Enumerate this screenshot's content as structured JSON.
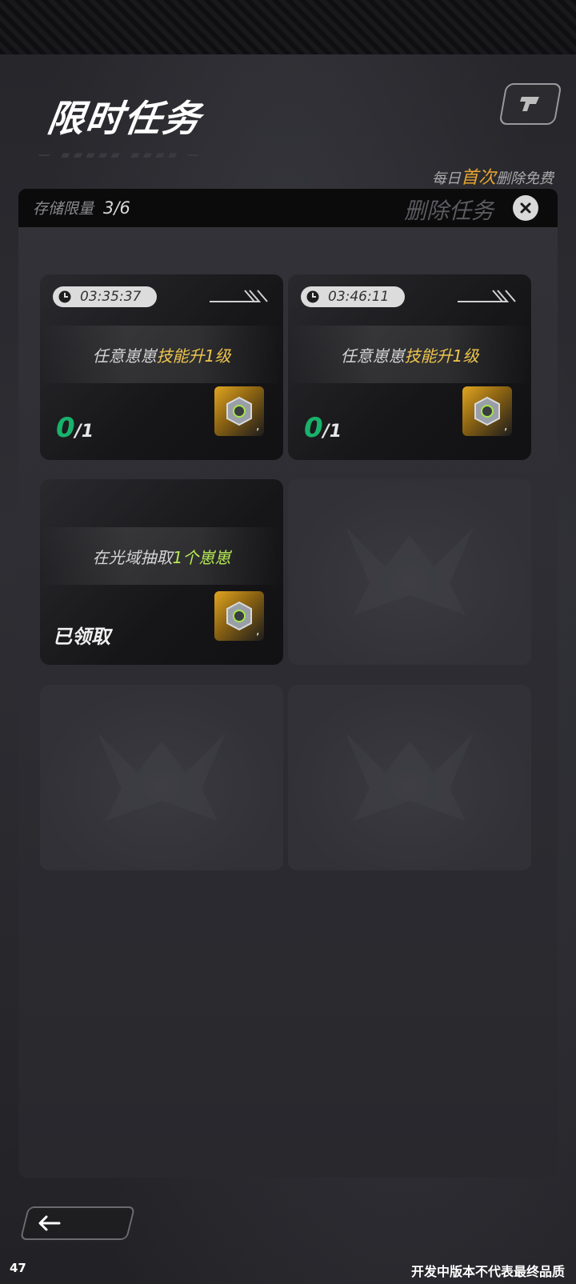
{
  "header": {
    "title": "限时任务",
    "daily_prefix": "每日",
    "daily_highlight": "首次",
    "daily_suffix": "删除免费"
  },
  "panel": {
    "storage_label": "存储限量",
    "storage_value": "3/6",
    "delete_label": "删除任务"
  },
  "cards": [
    {
      "timer": "03:35:37",
      "task_prefix": "任意崽崽",
      "task_highlight": "技能升1级",
      "progress_current": "0",
      "progress_total": "/1",
      "reward_count": ",",
      "highlight_color": "#efc54e"
    },
    {
      "timer": "03:46:11",
      "task_prefix": "任意崽崽",
      "task_highlight": "技能升1级",
      "progress_current": "0",
      "progress_total": "/1",
      "reward_count": ",",
      "highlight_color": "#efc54e"
    },
    {
      "task_prefix": "在光域抽取",
      "task_highlight": "1个崽崽",
      "status": "已领取",
      "reward_count": ",",
      "highlight_color": "#b6ea54"
    }
  ],
  "footer": {
    "left": "47",
    "right": "开发中版本不代表最终品质"
  },
  "icons": {
    "corner": "game-logo-icon",
    "close": "close-icon",
    "clock": "clock-icon",
    "reward": "hex-nut-icon",
    "back": "back-arrow-icon"
  },
  "colors": {
    "progress": "#17b36a",
    "accent": "#e6a430"
  }
}
